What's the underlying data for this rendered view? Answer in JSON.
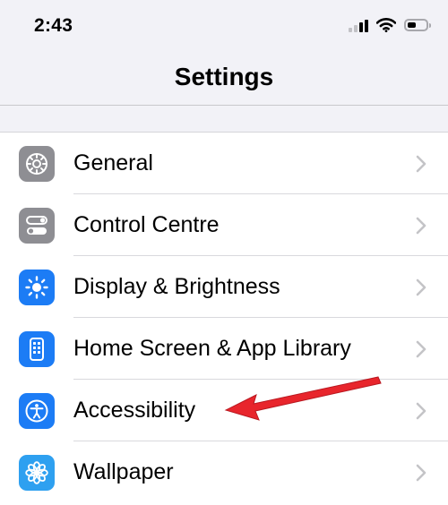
{
  "status_bar": {
    "time": "2:43"
  },
  "nav": {
    "title": "Settings"
  },
  "settings": {
    "items": [
      {
        "label": "General",
        "icon": "gear-icon",
        "tile_color": "#8e8e93"
      },
      {
        "label": "Control Centre",
        "icon": "toggle-switches-icon",
        "tile_color": "#8e8e93"
      },
      {
        "label": "Display & Brightness",
        "icon": "sun-icon",
        "tile_color": "#1c7cf5"
      },
      {
        "label": "Home Screen & App Library",
        "icon": "app-grid-phone-icon",
        "tile_color": "#1c7cf5"
      },
      {
        "label": "Accessibility",
        "icon": "accessibility-person-icon",
        "tile_color": "#1c7cf5"
      },
      {
        "label": "Wallpaper",
        "icon": "flower-icon",
        "tile_color": "#2ea0f0"
      }
    ]
  },
  "annotation": {
    "arrow_color": "#e8252c",
    "points_to": "Accessibility"
  }
}
